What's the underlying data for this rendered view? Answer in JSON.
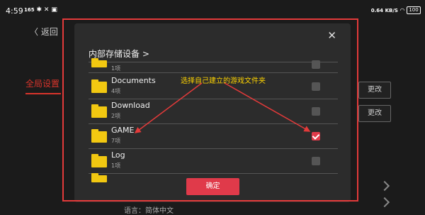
{
  "status_bar": {
    "time": "4:59",
    "left_indicator": "165",
    "net_speed_value": "0.64",
    "net_speed_unit": "KB/S",
    "battery": "100"
  },
  "background": {
    "back_label": "返回",
    "section_label": "全局设置",
    "change_buttons": [
      "更改",
      "更改"
    ],
    "language_row": "语言：简体中文"
  },
  "dialog": {
    "title": "内部存储设备 >",
    "close_icon": "close-icon",
    "folders": [
      {
        "name": "",
        "sub": "1项",
        "checked": false
      },
      {
        "name": "Documents",
        "sub": "4项",
        "checked": false
      },
      {
        "name": "Download",
        "sub": "2项",
        "checked": false
      },
      {
        "name": "GAME",
        "sub": "7项",
        "checked": true
      },
      {
        "name": "Log",
        "sub": "1项",
        "checked": false
      },
      {
        "name": "",
        "sub": "",
        "checked": false
      }
    ],
    "annotation": "选择自己建立的游戏文件夹",
    "confirm_label": "确定"
  },
  "colors": {
    "accent_red": "#e03a4a",
    "folder_yellow": "#f2c811",
    "annotation_yellow": "#ffd400",
    "outline_red": "#e33a3a"
  }
}
